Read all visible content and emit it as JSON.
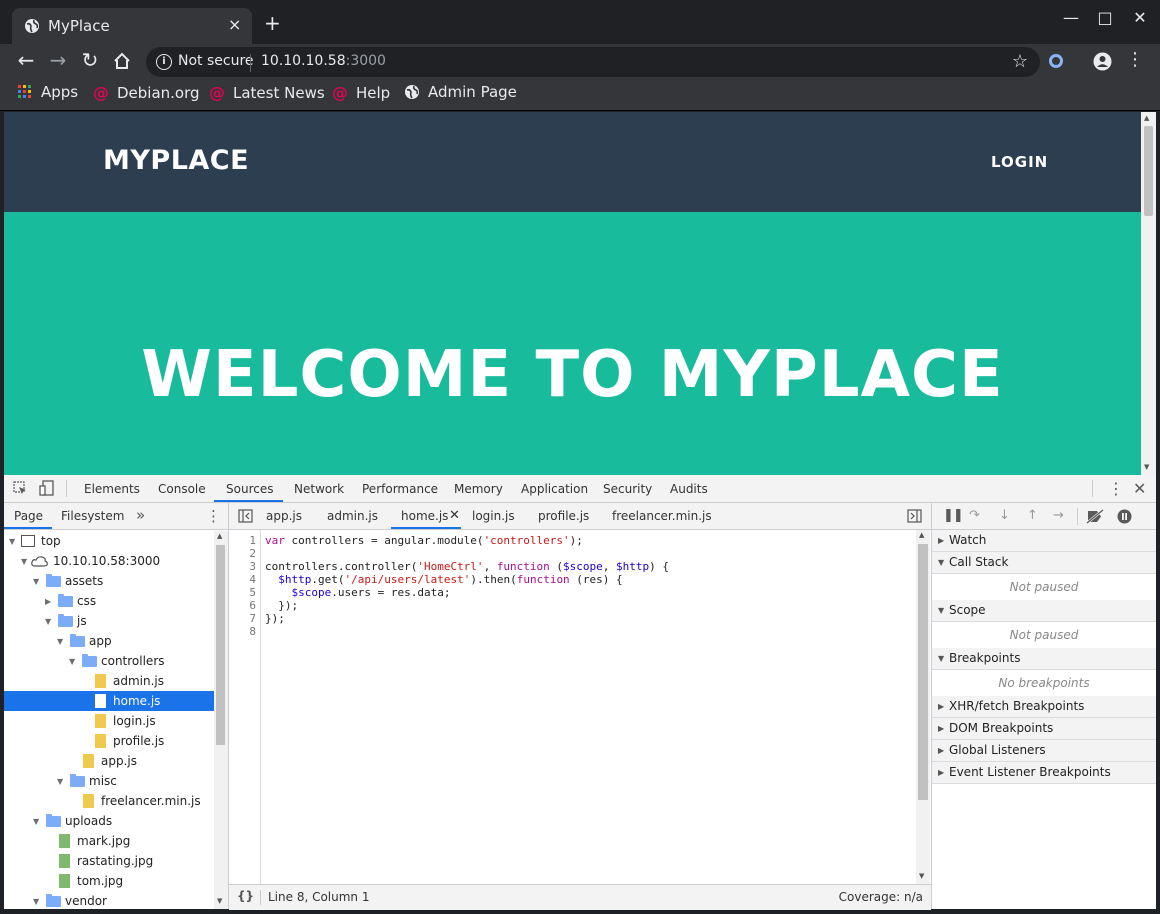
{
  "browser": {
    "tab_title": "MyPlace",
    "tab_close": "×",
    "new_tab": "+",
    "security_label": "Not secure",
    "url_host": "10.10.10.58",
    "url_port": ":3000",
    "bookmarks": [
      "Apps",
      "Debian.org",
      "Latest News",
      "Help",
      "Admin Page"
    ]
  },
  "page": {
    "brand": "MYPLACE",
    "login": "LOGIN",
    "headline": "WELCOME TO MYPLACE",
    "colors": {
      "navbar": "#2c3e50",
      "hero": "#18bc9c"
    }
  },
  "devtools": {
    "panels": [
      "Elements",
      "Console",
      "Sources",
      "Network",
      "Performance",
      "Memory",
      "Application",
      "Security",
      "Audits"
    ],
    "active_panel": "Sources",
    "navigator_tabs": [
      "Page",
      "Filesystem"
    ],
    "tree": [
      {
        "name": "top",
        "depth": 0
      },
      {
        "name": "10.10.10.58:3000",
        "depth": 1
      },
      {
        "name": "assets",
        "depth": 2
      },
      {
        "name": "css",
        "depth": 3
      },
      {
        "name": "js",
        "depth": 3
      },
      {
        "name": "app",
        "depth": 4
      },
      {
        "name": "controllers",
        "depth": 5
      },
      {
        "name": "admin.js",
        "depth": 6
      },
      {
        "name": "home.js",
        "depth": 6
      },
      {
        "name": "login.js",
        "depth": 6
      },
      {
        "name": "profile.js",
        "depth": 6
      },
      {
        "name": "app.js",
        "depth": 5
      },
      {
        "name": "misc",
        "depth": 4
      },
      {
        "name": "freelancer.min.js",
        "depth": 5
      },
      {
        "name": "uploads",
        "depth": 2
      },
      {
        "name": "mark.jpg",
        "depth": 3
      },
      {
        "name": "rastating.jpg",
        "depth": 3
      },
      {
        "name": "tom.jpg",
        "depth": 3
      },
      {
        "name": "vendor",
        "depth": 2
      }
    ],
    "editor_tabs": [
      "app.js",
      "admin.js",
      "home.js",
      "login.js",
      "profile.js",
      "freelancer.min.js"
    ],
    "active_editor_tab": "home.js",
    "code_lines": [
      "var controllers = angular.module('controllers');",
      "",
      "controllers.controller('HomeCtrl', function ($scope, $http) {",
      "  $http.get('/api/users/latest').then(function (res) {",
      "    $scope.users = res.data;",
      "  });",
      "});",
      ""
    ],
    "status_position": "Line 8, Column 1",
    "status_coverage": "Coverage: n/a",
    "format_button": "{}",
    "debugger_sections": {
      "watch": "Watch",
      "call_stack": "Call Stack",
      "call_stack_body": "Not paused",
      "scope": "Scope",
      "scope_body": "Not paused",
      "breakpoints": "Breakpoints",
      "breakpoints_body": "No breakpoints",
      "xhr": "XHR/fetch Breakpoints",
      "dom": "DOM Breakpoints",
      "global": "Global Listeners",
      "event": "Event Listener Breakpoints"
    }
  }
}
